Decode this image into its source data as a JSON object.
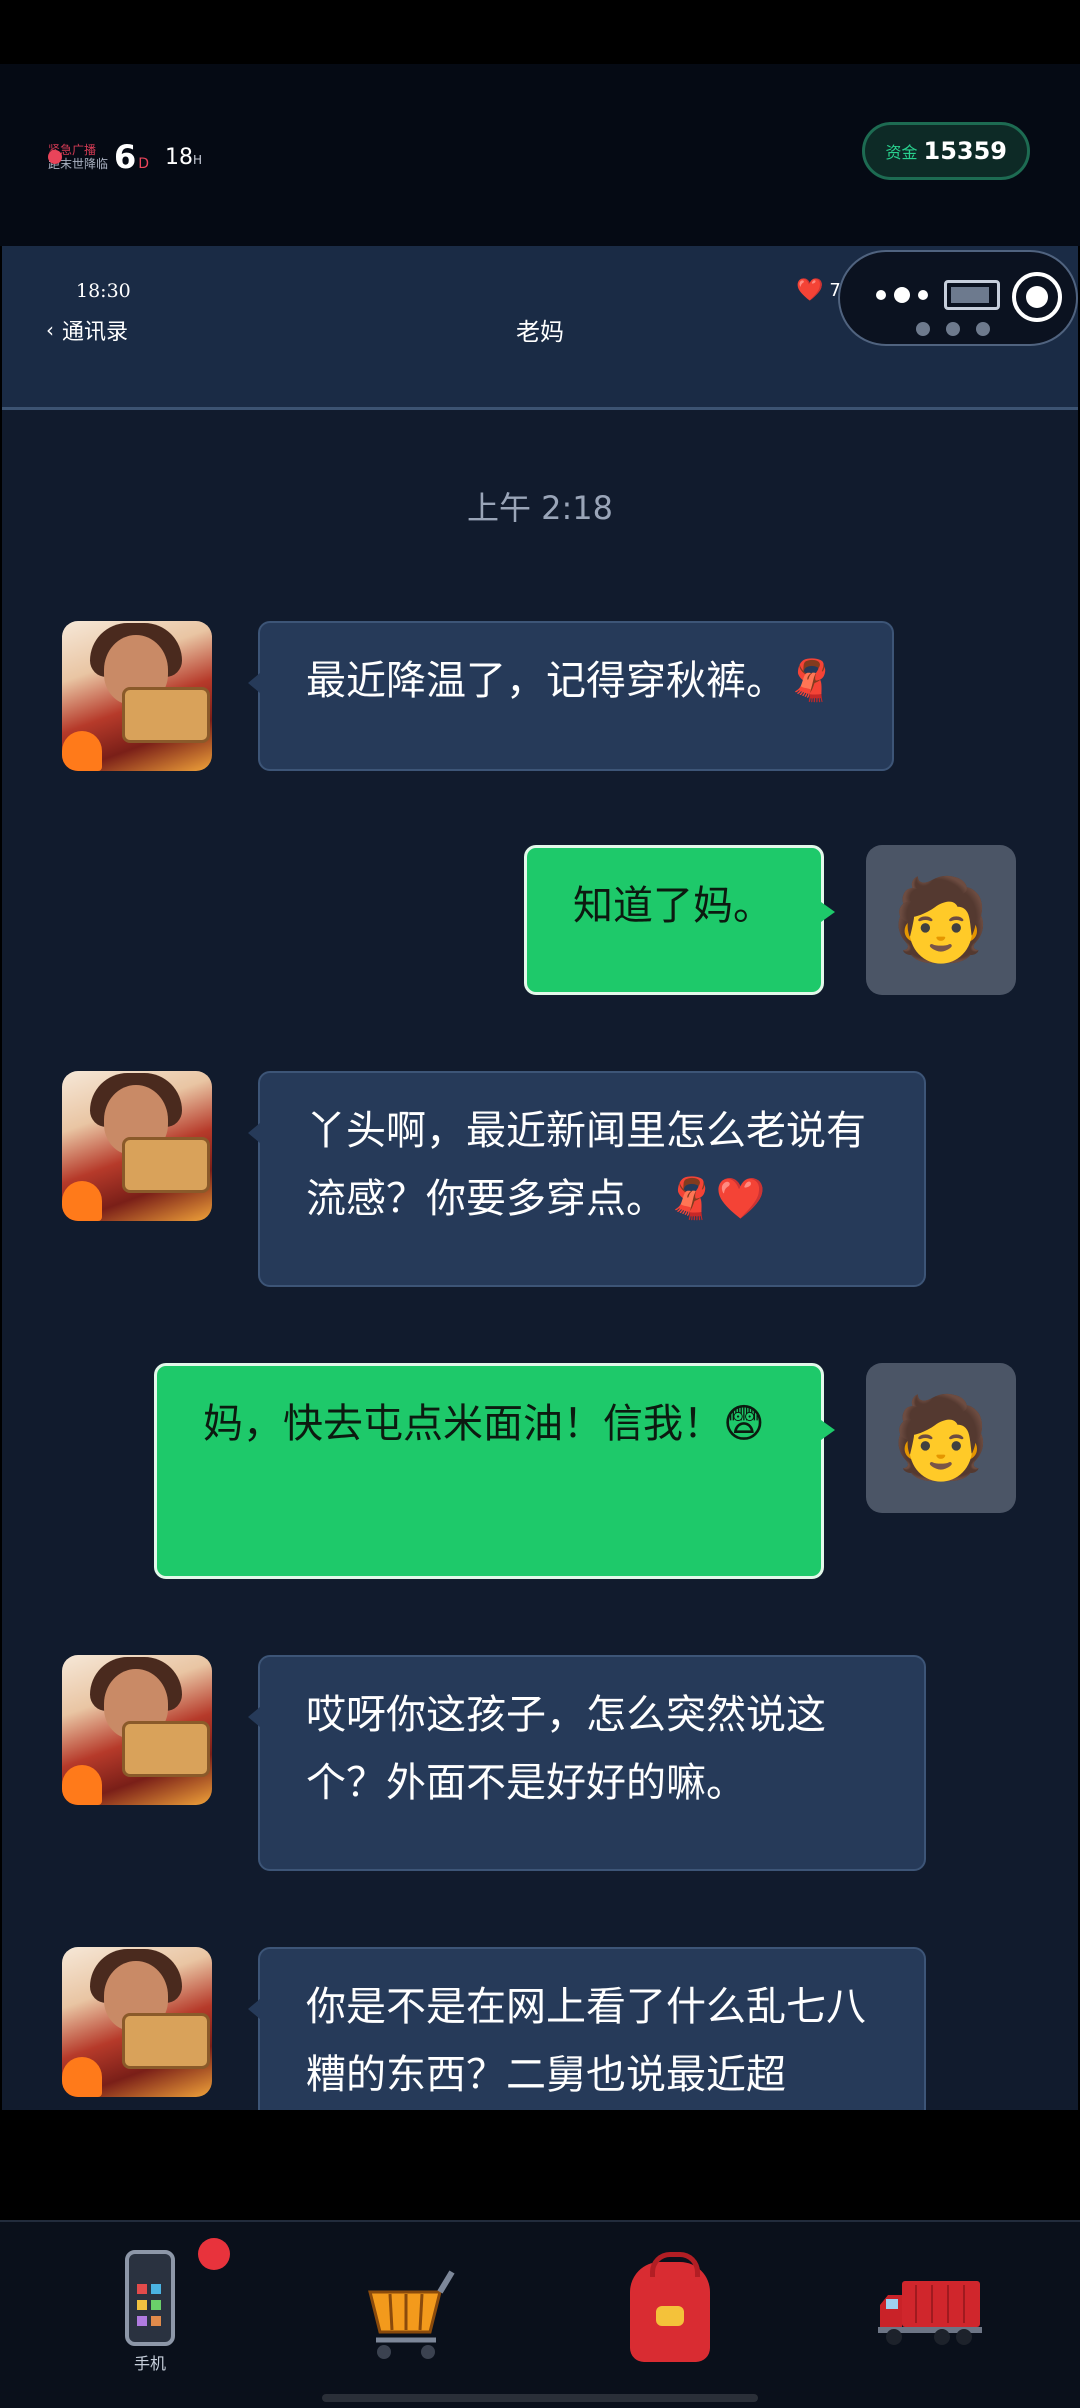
{
  "hud": {
    "alert_line1": "紧急广播",
    "alert_line2": "距末世降临",
    "days": "6",
    "days_unit": "D",
    "hours": "18",
    "hours_unit": "H",
    "money_label": "资金",
    "money_value": "15359"
  },
  "phone": {
    "time": "18:30",
    "back_label": "通讯录",
    "contact_name": "老妈",
    "hearts": "75",
    "heart_icon": "❤️"
  },
  "chat": {
    "timestamp": "上午 2:18",
    "messages": [
      {
        "from": "mom",
        "text": "最近降温了，记得穿秋裤。🧣"
      },
      {
        "from": "me",
        "text": "知道了妈。"
      },
      {
        "from": "mom",
        "text": "丫头啊，最近新闻里怎么老说有流感？你要多穿点。🧣❤️"
      },
      {
        "from": "me",
        "text": "妈，快去屯点米面油！信我！😨"
      },
      {
        "from": "mom",
        "text": "哎呀你这孩子，怎么突然说这个？外面不是好好的嘛。"
      },
      {
        "from": "mom",
        "text": "你是不是在网上看了什么乱七八糟的东西？二舅也说最近超"
      }
    ],
    "me_avatar": "🧑"
  },
  "nav": {
    "items": [
      {
        "label": "手机",
        "icon": "phone-icon"
      },
      {
        "label": "",
        "icon": "cart-icon"
      },
      {
        "label": "",
        "icon": "backpack-icon"
      },
      {
        "label": "",
        "icon": "truck-icon"
      }
    ]
  },
  "colors": {
    "incoming_bubble": "#263a59",
    "outgoing_bubble": "#1ec96a",
    "alert_red": "#e9445a",
    "money_green": "#29d18e"
  }
}
